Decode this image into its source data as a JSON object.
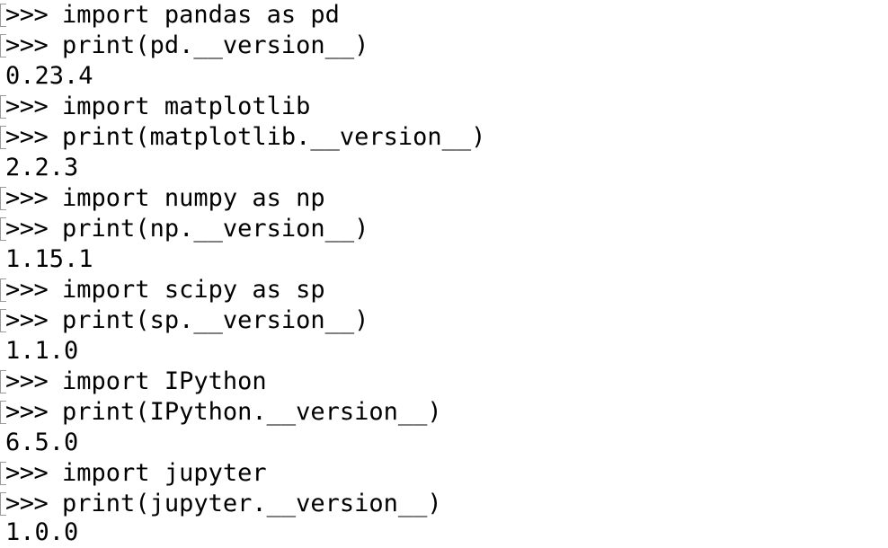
{
  "terminal": {
    "prompt": ">>> ",
    "lines": [
      {
        "type": "input",
        "text": "import pandas as pd"
      },
      {
        "type": "input",
        "text": "print(pd.__version__)"
      },
      {
        "type": "output",
        "text": "0.23.4"
      },
      {
        "type": "input",
        "text": "import matplotlib"
      },
      {
        "type": "input",
        "text": "print(matplotlib.__version__)"
      },
      {
        "type": "output",
        "text": "2.2.3"
      },
      {
        "type": "input",
        "text": "import numpy as np"
      },
      {
        "type": "input",
        "text": "print(np.__version__)"
      },
      {
        "type": "output",
        "text": "1.15.1"
      },
      {
        "type": "input",
        "text": "import scipy as sp"
      },
      {
        "type": "input",
        "text": "print(sp.__version__)"
      },
      {
        "type": "output",
        "text": "1.1.0"
      },
      {
        "type": "input",
        "text": "import IPython"
      },
      {
        "type": "input",
        "text": "print(IPython.__version__)"
      },
      {
        "type": "output",
        "text": "6.5.0"
      },
      {
        "type": "input",
        "text": "import jupyter"
      },
      {
        "type": "input",
        "text": "print(jupyter.__version__)"
      },
      {
        "type": "output",
        "text": "1.0.0"
      }
    ]
  }
}
